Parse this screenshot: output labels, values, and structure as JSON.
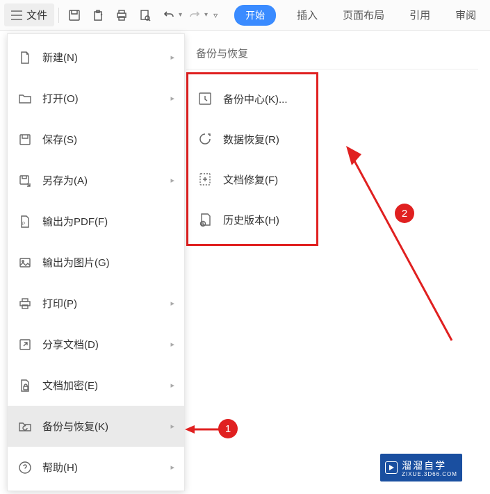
{
  "toolbar": {
    "file_label": "文件"
  },
  "tabs": {
    "start": "开始",
    "insert": "插入",
    "layout": "页面布局",
    "reference": "引用",
    "review": "审阅"
  },
  "menu": {
    "new": "新建(N)",
    "open": "打开(O)",
    "save": "保存(S)",
    "save_as": "另存为(A)",
    "export_pdf": "输出为PDF(F)",
    "export_img": "输出为图片(G)",
    "print": "打印(P)",
    "share": "分享文档(D)",
    "encrypt": "文档加密(E)",
    "backup": "备份与恢复(K)",
    "help": "帮助(H)"
  },
  "submenu": {
    "title": "备份与恢复",
    "backup_center": "备份中心(K)...",
    "data_recover": "数据恢复(R)",
    "doc_repair": "文档修复(F)",
    "history": "历史版本(H)"
  },
  "badges": {
    "one": "1",
    "two": "2"
  },
  "watermark": {
    "main": "溜溜自学",
    "sub": "ZIXUE.3D66.COM"
  }
}
